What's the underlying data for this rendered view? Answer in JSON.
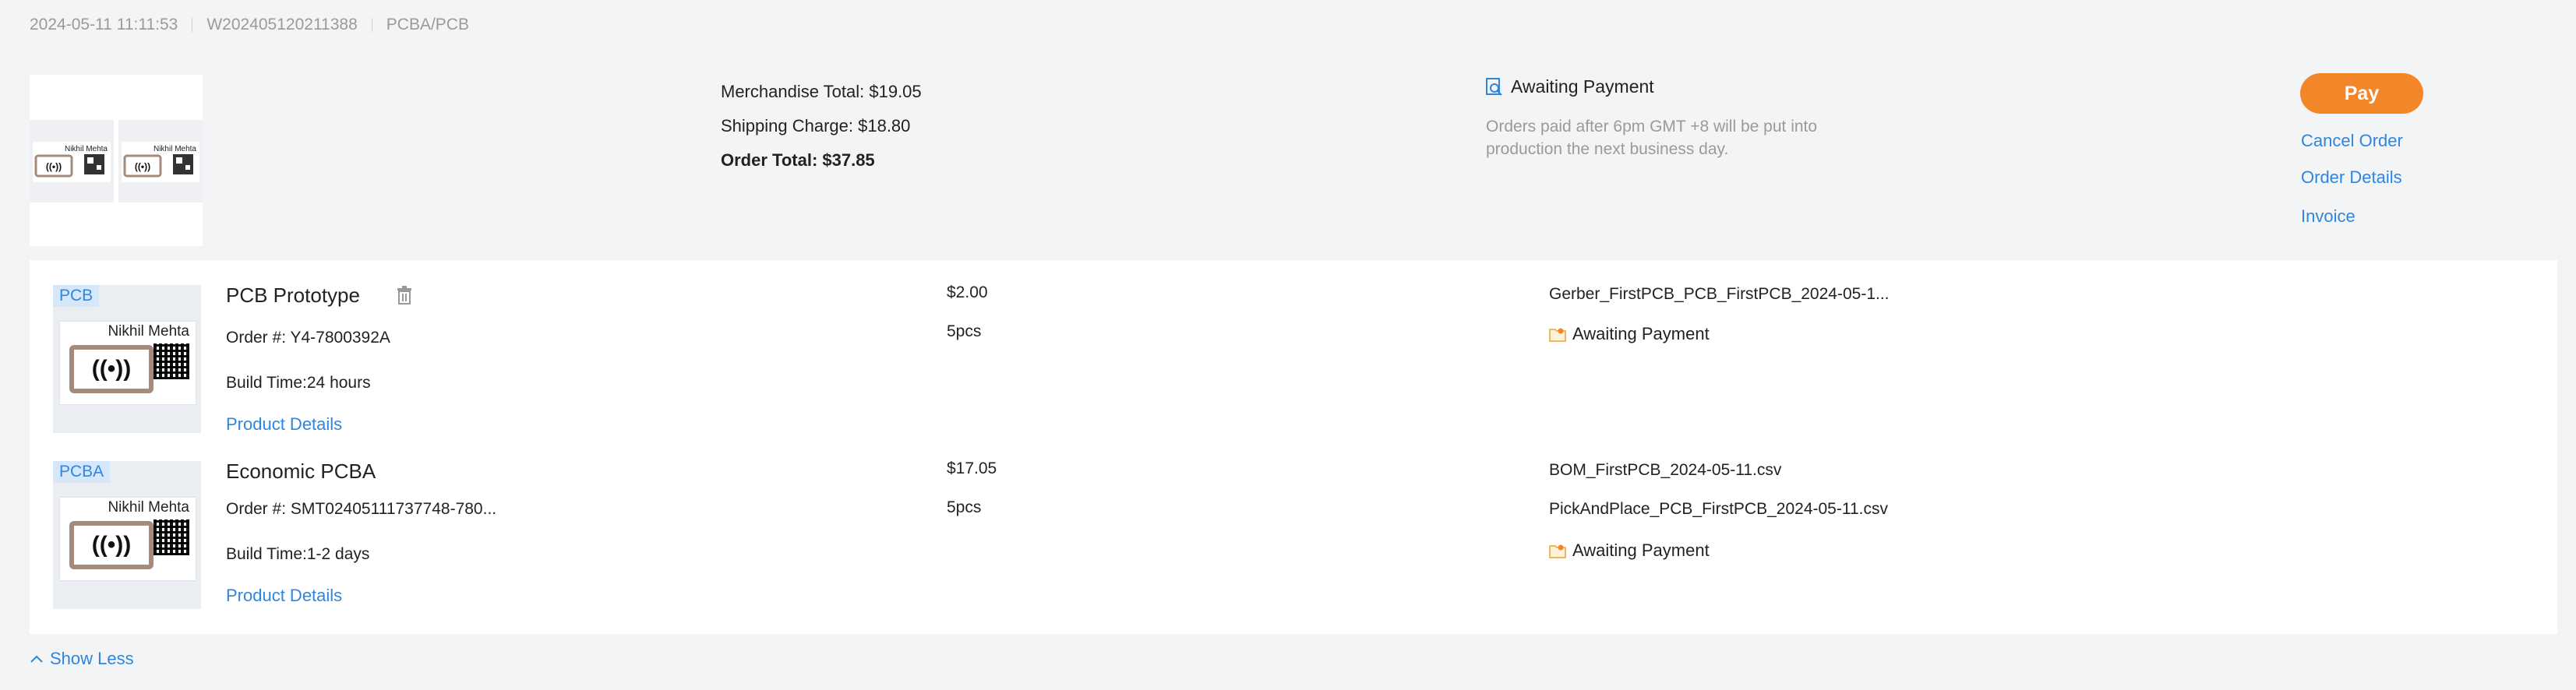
{
  "header": {
    "datetime": "2024-05-11 11:11:53",
    "order_id": "W202405120211388",
    "category": "PCBA/PCB"
  },
  "summary": {
    "merchandise_total": "Merchandise Total: $19.05",
    "shipping_charge": "Shipping Charge: $18.80",
    "order_total": "Order Total: $37.85",
    "status": "Awaiting Payment",
    "status_note": "Orders paid after 6pm GMT +8 will be put into production the next business day.",
    "pay_label": "Pay",
    "cancel_label": "Cancel Order",
    "details_label": "Order Details",
    "invoice_label": "Invoice",
    "thumb_name": "Nikhil Mehta"
  },
  "items": [
    {
      "tag": "PCB",
      "image_name": "Nikhil Mehta",
      "title": "PCB Prototype",
      "order_no": "Order #: Y4-7800392A",
      "build_time": "Build Time:24 hours",
      "details_link": "Product Details",
      "price": "$2.00",
      "qty": "5pcs",
      "files": [
        "Gerber_FirstPCB_PCB_FirstPCB_2024-05-1..."
      ],
      "status": "Awaiting Payment"
    },
    {
      "tag": "PCBA",
      "image_name": "Nikhil Mehta",
      "title": "Economic PCBA",
      "order_no": "Order #: SMT02405111737748-780...",
      "build_time": "Build Time:1-2 days",
      "details_link": "Product Details",
      "price": "$17.05",
      "qty": "5pcs",
      "files": [
        "BOM_FirstPCB_2024-05-11.csv",
        "PickAndPlace_PCB_FirstPCB_2024-05-11.csv"
      ],
      "status": "Awaiting Payment"
    }
  ],
  "footer": {
    "show_less": "Show Less"
  },
  "icons": {
    "status": "magnifier-document-icon",
    "item_status": "folder-icon",
    "delete": "trash-icon",
    "collapse": "chevron-up-icon"
  },
  "colors": {
    "accent": "#f4862a",
    "link": "#2e86de",
    "tag_bg": "#d7e7fa"
  }
}
